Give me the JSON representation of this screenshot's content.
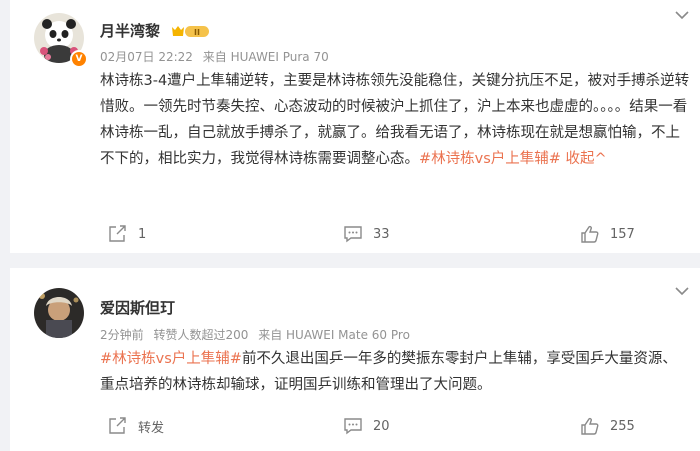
{
  "posts": [
    {
      "author": "月半湾黎",
      "meta": {
        "time": "02月07日 22:22",
        "source": "来自 HUAWEI Pura 70"
      },
      "text_plain": "林诗栋3-4遭户上隼辅逆转，主要是林诗栋领先没能稳住，关键分抗压不足，被对手搏杀逆转惜败。一领先时节奏失控、心态波动的时候被沪上抓住了，沪上本来也虚虚的。。。。结果一看林诗栋一乱，自己就放手搏杀了，就赢了。给我看无语了，林诗栋现在就是想赢怕输，不上不下的，相比实力，我觉得林诗栋需要调整心态。",
      "hashtag": "#林诗栋vs户上隼辅#",
      "collapse": "收起^",
      "stats": {
        "repost": "1",
        "comment": "33",
        "like": "157"
      }
    },
    {
      "author": "爱因斯但玎",
      "meta": {
        "time": "2分钟前",
        "extra": "转赞人数超过200",
        "source": "来自 HUAWEI Mate 60 Pro"
      },
      "hashtag": "#林诗栋vs户上隼辅#",
      "text_plain": "前不久退出国乒一年多的樊振东零封户上隼辅，享受国乒大量资源、重点培养的林诗栋却输球，证明国乒训练和管理出了大问题。",
      "stats": {
        "repost": "转发",
        "comment": "20",
        "like": "255"
      }
    }
  ]
}
